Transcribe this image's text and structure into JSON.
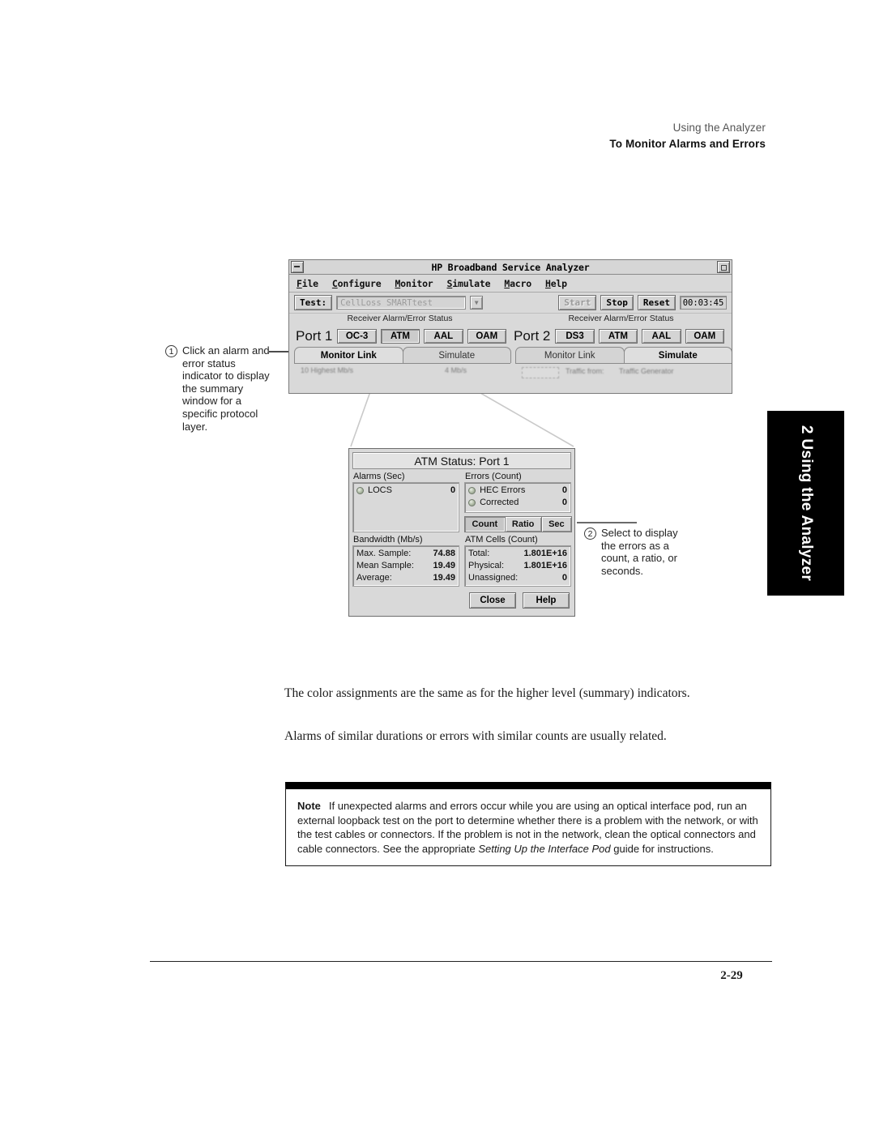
{
  "page_header": {
    "line1": "Using the Analyzer",
    "line2": "To Monitor Alarms and Errors"
  },
  "chapter_tab": {
    "label": "2  Using the Analyzer"
  },
  "analyzer_window": {
    "title": "HP Broadband Service Analyzer",
    "window_minimize_icon": "minimize-icon",
    "window_maximize_icon": "maximize-icon",
    "menu": [
      {
        "mnemonic": "F",
        "rest": "ile"
      },
      {
        "mnemonic": "C",
        "rest": "onfigure"
      },
      {
        "mnemonic": "M",
        "rest": "onitor"
      },
      {
        "mnemonic": "S",
        "rest": "imulate"
      },
      {
        "mnemonic": "M",
        "rest": "acro"
      },
      {
        "mnemonic": "H",
        "rest": "elp"
      }
    ],
    "toolbar": {
      "test_label": "Test:",
      "test_value": "CellLoss SMARTtest",
      "dropdown_icon": "chevron-down-icon",
      "start_label": "Start",
      "stop_label": "Stop",
      "reset_label": "Reset",
      "timer": "00:03:45"
    },
    "status_caption_left": "Receiver Alarm/Error Status",
    "status_caption_right": "Receiver Alarm/Error Status",
    "port1": {
      "label": "Port 1",
      "buttons": [
        "OC-3",
        "ATM",
        "AAL",
        "OAM"
      ],
      "selected_button": "ATM",
      "tabs": [
        "Monitor Link",
        "Simulate"
      ],
      "active_tab": "Monitor Link",
      "body_text_1": "10 Highest Mb/s",
      "body_text_2": "4 Mb/s"
    },
    "port2": {
      "label": "Port 2",
      "buttons": [
        "DS3",
        "ATM",
        "AAL",
        "OAM"
      ],
      "tabs": [
        "Monitor Link",
        "Simulate"
      ],
      "active_tab": "Simulate",
      "body_text_1": "Traffic from:",
      "body_text_2": "Traffic Generator"
    }
  },
  "atm_dialog": {
    "title": "ATM Status: Port 1",
    "alarms_caption": "Alarms (Sec)",
    "alarms": [
      {
        "indicator": "status-led",
        "name": "LOCS",
        "value": "0"
      }
    ],
    "errors_caption": "Errors (Count)",
    "errors": [
      {
        "indicator": "status-led",
        "name": "HEC Errors",
        "value": "0"
      },
      {
        "indicator": "status-led",
        "name": "Corrected",
        "value": "0"
      }
    ],
    "units": {
      "options": [
        "Count",
        "Ratio",
        "Sec"
      ],
      "selected": "Count"
    },
    "bandwidth_caption": "Bandwidth (Mb/s)",
    "bandwidth": [
      {
        "label": "Max. Sample:",
        "value": "74.88"
      },
      {
        "label": "Mean Sample:",
        "value": "19.49"
      },
      {
        "label": "Average:",
        "value": "19.49"
      }
    ],
    "cells_caption": "ATM Cells (Count)",
    "cells": [
      {
        "label": "Total:",
        "value": "1.801E+16"
      },
      {
        "label": "Physical:",
        "value": "1.801E+16"
      },
      {
        "label": "Unassigned:",
        "value": "0"
      }
    ],
    "close_label": "Close",
    "help_label": "Help"
  },
  "callouts": [
    {
      "number": "1",
      "text": "Click an alarm and error status indicator to display the summary window for a specific protocol layer."
    },
    {
      "number": "2",
      "text": "Select to display the errors as a count, a ratio, or seconds."
    }
  ],
  "body": {
    "para1": "The color assignments are the same as for the higher level (summary) indicators.",
    "para2": "Alarms of similar durations or errors with similar counts are usually related."
  },
  "note": {
    "label": "Note",
    "text_part1": "If unexpected alarms and errors occur while you are using an optical interface pod, run an external loopback test on the port to determine whether there is a problem with the network, or with the test cables or connectors. If the problem is not in the network, clean the optical connectors and cable connectors. See the appropriate ",
    "italic_title": "Setting Up the Interface Pod",
    "text_part2": " guide for instructions."
  },
  "footer": {
    "page_number": "2-29"
  }
}
